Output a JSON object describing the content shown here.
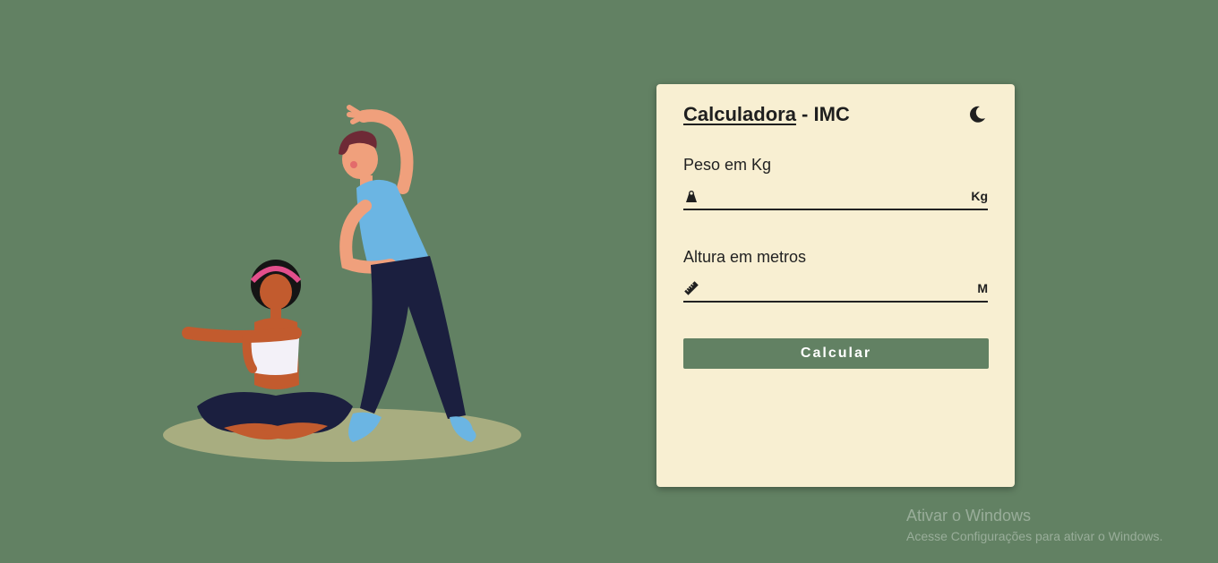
{
  "card": {
    "title_underlined": "Calculadora",
    "title_rest": " - IMC",
    "theme_toggle_icon": "moon-icon",
    "weight": {
      "label": "Peso em Kg",
      "icon": "weight-icon",
      "value": "",
      "placeholder": "",
      "unit": "Kg"
    },
    "height": {
      "label": "Altura em metros",
      "icon": "ruler-icon",
      "value": "",
      "placeholder": "",
      "unit": "M"
    },
    "button_label": "Calcular"
  },
  "watermark": {
    "title": "Ativar o Windows",
    "subtitle": "Acesse Configurações para ativar o Windows."
  },
  "colors": {
    "background": "#628163",
    "card": "#f8efd2",
    "button": "#628163",
    "text": "#1f1f1f"
  }
}
